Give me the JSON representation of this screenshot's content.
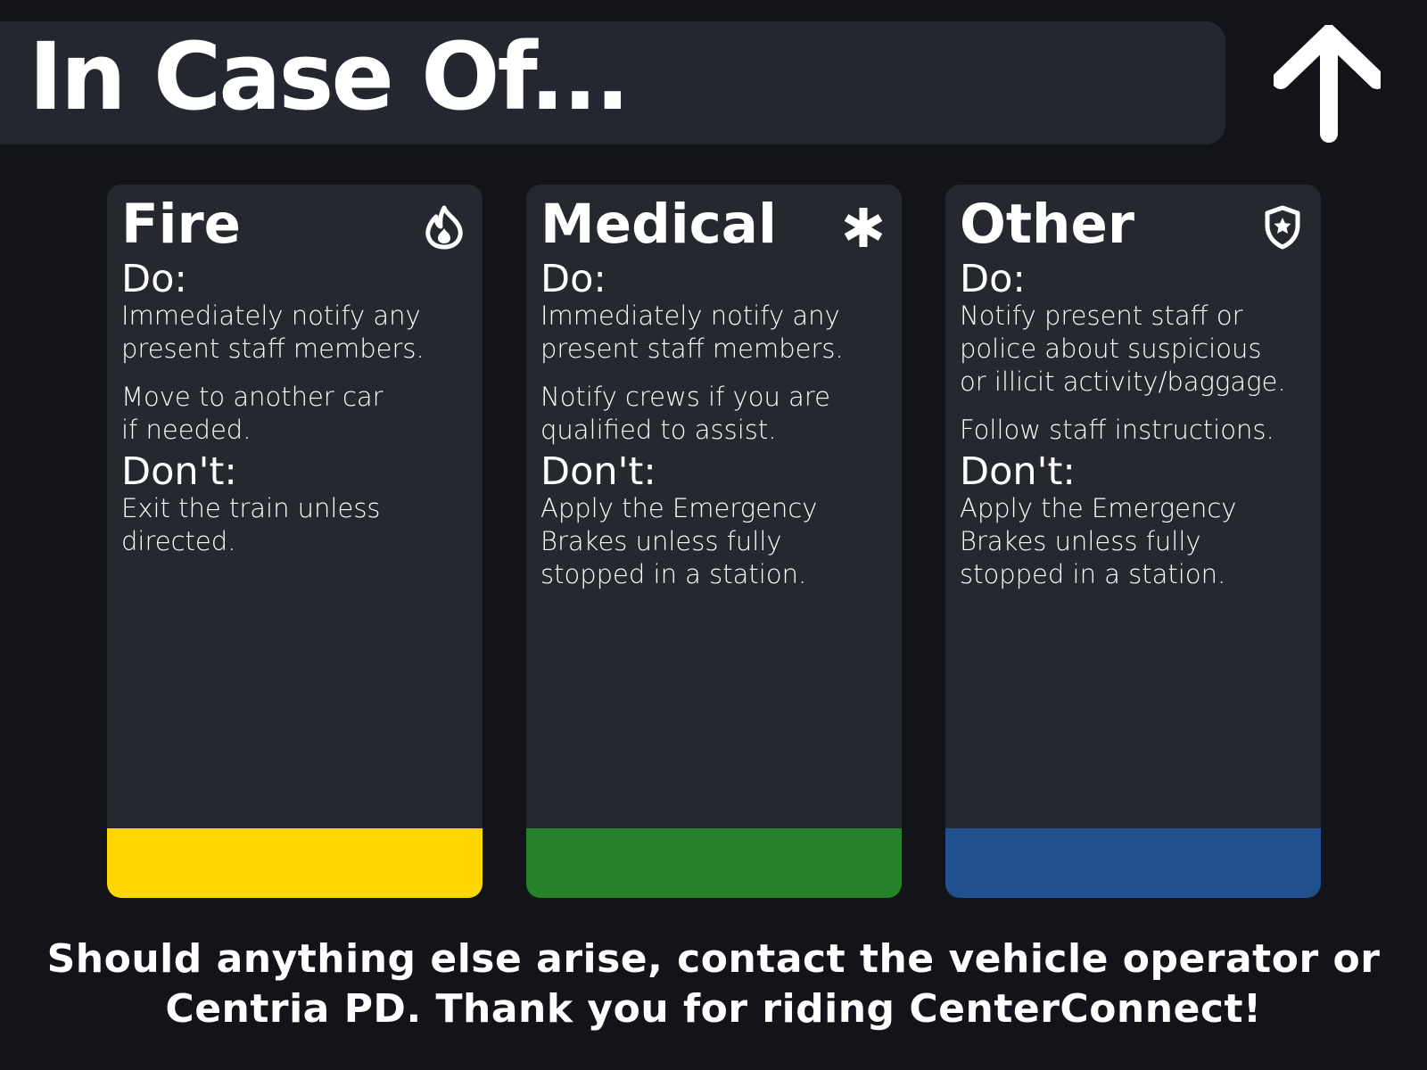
{
  "header": {
    "title": "In Case Of...",
    "arrow_icon": "arrow-up-icon"
  },
  "cards": [
    {
      "heading": "Fire",
      "icon": "flame-icon",
      "accent_color": "#FFD700",
      "do_label": "Do:",
      "do_items": [
        "Immediately notify any\npresent staff members.",
        "Move to another car\nif needed."
      ],
      "dont_label": "Don't:",
      "dont_items": [
        "Exit the train unless\ndirected."
      ]
    },
    {
      "heading": "Medical",
      "icon": "asterisk-icon",
      "accent_color": "#258228",
      "do_label": "Do:",
      "do_items": [
        "Immediately notify any\npresent staff members.",
        "Notify crews if you are\nqualified to assist."
      ],
      "dont_label": "Don't:",
      "dont_items": [
        "Apply the Emergency\nBrakes unless fully\nstopped in a station."
      ]
    },
    {
      "heading": "Other",
      "icon": "police-shield-star-icon",
      "accent_color": "#20508D",
      "do_label": "Do:",
      "do_items": [
        "Notify present staff or\npolice about suspicious\nor illicit activity/baggage.",
        "Follow staff instructions."
      ],
      "dont_label": "Don't:",
      "dont_items": [
        "Apply the Emergency\nBrakes unless fully\nstopped in a station."
      ]
    }
  ],
  "footer": {
    "text": "Should anything else arise, contact the vehicle operator or\nCentria PD. Thank you for riding CenterConnect!"
  },
  "colors": {
    "background": "#131419",
    "panel": "#262830",
    "title_bar": "#242730",
    "text": "#FFFFFF"
  }
}
